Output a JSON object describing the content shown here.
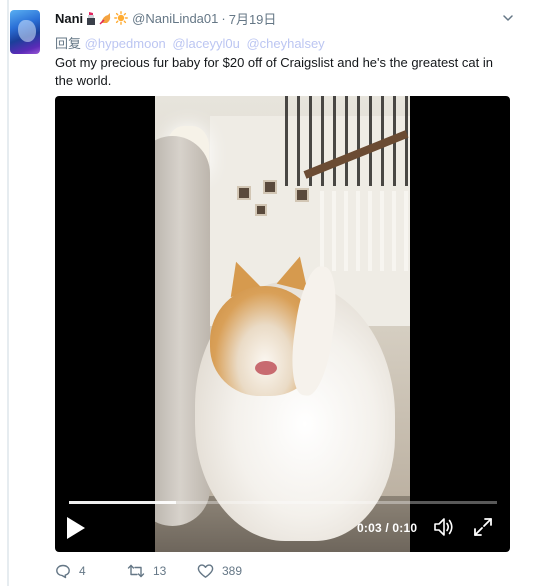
{
  "tweet": {
    "author": {
      "name": "Nani",
      "handle": "@NaniLinda01",
      "emoji_icons": [
        "lipstick-icon",
        "cat-icon",
        "sun-icon"
      ]
    },
    "separator": "·",
    "date": "7月19日",
    "reply_prefix": "回复",
    "mentions": [
      "@hypedmoon",
      "@laceyyl0u",
      "@cheyhalsey"
    ],
    "text": "Got my precious fur baby for $20 off of Craigslist and he's the greatest cat in the world.",
    "media": {
      "type": "video",
      "time_display": "0:03 / 0:10",
      "progress": 0.25
    },
    "actions": {
      "reply_count": "4",
      "retweet_count": "13",
      "like_count": "389"
    }
  },
  "colors": {
    "text": "#14171a",
    "muted": "#657786",
    "mention": "#bcc6f2",
    "background": "#ffffff"
  }
}
